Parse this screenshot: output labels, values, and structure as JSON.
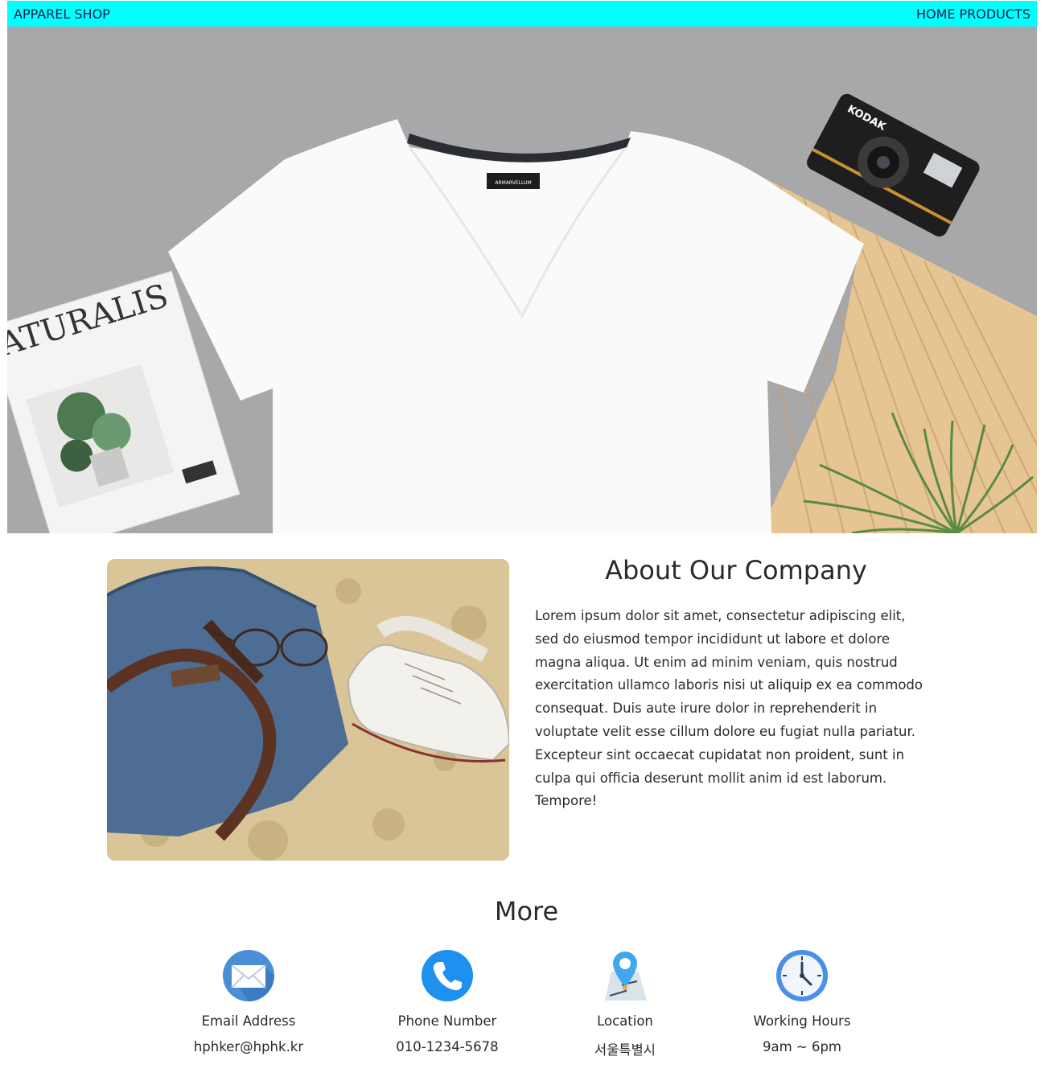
{
  "navbar": {
    "brand": "APPAREL SHOP",
    "links": [
      "HOME",
      "PRODUCTS"
    ],
    "background": "#00ffff"
  },
  "hero": {
    "image": "flat-lay-white-tshirt-with-camera-magazine-palm-leaf",
    "magazine_title": "ATURALIS",
    "camera_brand": "KODAK",
    "shirt_label": "ARMARVELLUM"
  },
  "about": {
    "image": "denim-bag-sneakers-glasses-on-sand",
    "title": "About Our Company",
    "body": "Lorem ipsum dolor sit amet, consectetur adipiscing elit, sed do eiusmod tempor incididunt ut labore et dolore magna aliqua. Ut enim ad minim veniam, quis nostrud exercitation ullamco laboris nisi ut aliquip ex ea commodo consequat. Duis aute irure dolor in reprehenderit in voluptate velit esse cillum dolore eu fugiat nulla pariatur. Excepteur sint occaecat cupidatat non proident, sunt in culpa qui officia deserunt mollit anim id est laborum. Tempore!"
  },
  "more": {
    "title": "More",
    "items": [
      {
        "icon": "envelope-icon",
        "label": "Email Address",
        "value": "hphker@hphk.kr"
      },
      {
        "icon": "phone-icon",
        "label": "Phone Number",
        "value": "010-1234-5678"
      },
      {
        "icon": "map-pin-icon",
        "label": "Location",
        "value": "서울특별시"
      },
      {
        "icon": "clock-icon",
        "label": "Working Hours",
        "value": "9am ~ 6pm"
      }
    ]
  }
}
